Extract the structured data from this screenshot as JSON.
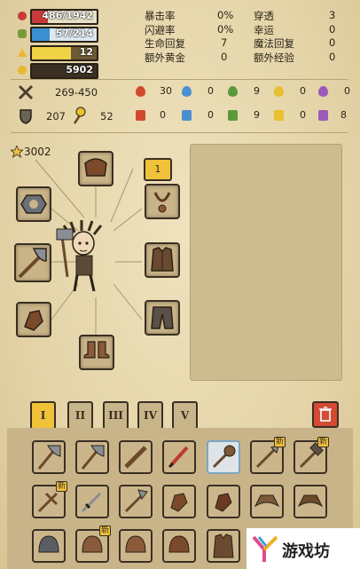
{
  "stats": {
    "hp": "486/1942",
    "mp": "57/214",
    "gold_level": "12",
    "gold": "5902",
    "hp_fraction": 0.25,
    "mp_fraction": 0.27,
    "xp_fraction": 0.6
  },
  "attrs": {
    "crit_label": "暴击率",
    "crit_value": "0%",
    "pierce_label": "穿透",
    "pierce_value": "3",
    "dodge_label": "闪避率",
    "dodge_value": "0%",
    "luck_label": "幸运",
    "luck_value": "0",
    "hp_regen_label": "生命回复",
    "hp_regen_value": "7",
    "mp_regen_label": "魔法回复",
    "mp_regen_value": "0",
    "extra_gold_label": "额外黄金",
    "extra_gold_value": "0",
    "extra_xp_label": "额外经验",
    "extra_xp_value": "0"
  },
  "combat": {
    "attack_range": "269-450",
    "defense": "207",
    "magic_def": "52"
  },
  "elements_attack": [
    "30",
    "0",
    "9",
    "0",
    "0"
  ],
  "elements_defense": [
    "0",
    "0",
    "9",
    "0",
    "8"
  ],
  "equipment": {
    "star_value": "3002",
    "tag_value": "1"
  },
  "tabs": [
    "I",
    "II",
    "III",
    "IV",
    "V"
  ],
  "new_badge": "新",
  "colors": {
    "hp": "#c83a3a",
    "mp": "#3a8fd0",
    "xp": "#f0d246",
    "tab_active": "#f0c23a",
    "trash": "#d44a34"
  }
}
